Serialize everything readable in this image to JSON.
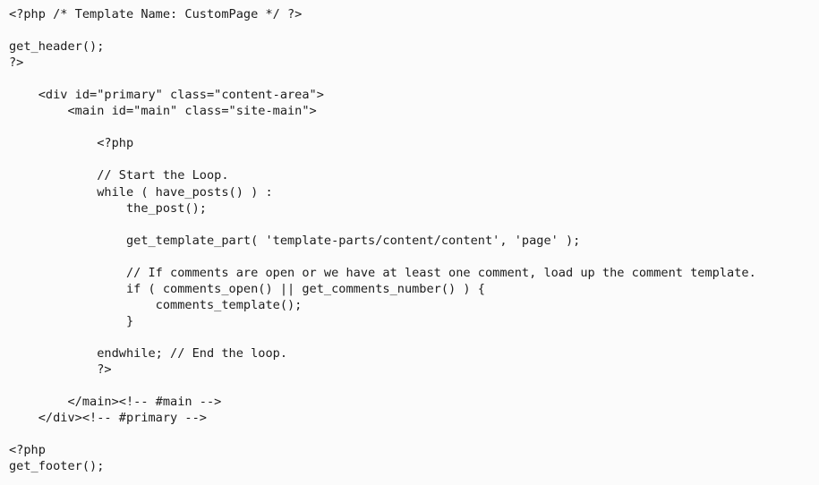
{
  "editor": {
    "language": "php",
    "background_color": "#fbfbfb",
    "text_color": "#1c1c1c",
    "template_name": "CustomPage",
    "lines": [
      "<?php /* Template Name: CustomPage */ ?>",
      "",
      "get_header();",
      "?>",
      "",
      "    <div id=\"primary\" class=\"content-area\">",
      "        <main id=\"main\" class=\"site-main\">",
      "",
      "            <?php",
      "",
      "            // Start the Loop.",
      "            while ( have_posts() ) :",
      "                the_post();",
      "",
      "                get_template_part( 'template-parts/content/content', 'page' );",
      "",
      "                // If comments are open or we have at least one comment, load up the comment template.",
      "                if ( comments_open() || get_comments_number() ) {",
      "                    comments_template();",
      "                }",
      "",
      "            endwhile; // End the loop.",
      "            ?>",
      "",
      "        </main><!-- #main -->",
      "    </div><!-- #primary -->",
      "",
      "<?php",
      "get_footer();"
    ]
  }
}
